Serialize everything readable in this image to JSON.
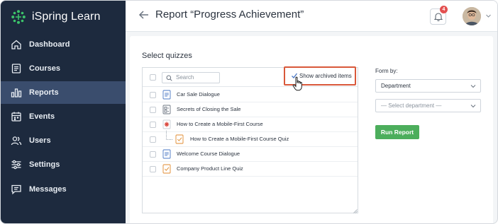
{
  "app": {
    "brand_name": "iSpring Learn",
    "brand_color": "#3cc46a",
    "sidebar_bg": "#1d2a3e",
    "active_bg": "#3a4d6d"
  },
  "sidebar": {
    "items": [
      {
        "label": "Dashboard",
        "icon": "home-icon"
      },
      {
        "label": "Courses",
        "icon": "courses-icon"
      },
      {
        "label": "Reports",
        "icon": "bar-chart-icon",
        "active": true
      },
      {
        "label": "Events",
        "icon": "calendar-icon"
      },
      {
        "label": "Users",
        "icon": "users-icon"
      },
      {
        "label": "Settings",
        "icon": "sliders-icon"
      },
      {
        "label": "Messages",
        "icon": "message-icon"
      }
    ]
  },
  "header": {
    "title": "Report “Progress Achievement”",
    "notification_count": "4"
  },
  "main": {
    "section_title": "Select quizzes",
    "search_placeholder": "Search",
    "show_archived_label": "Show archived items",
    "quizzes": [
      {
        "label": "Car Sale Dialogue",
        "icon": "dialogue-icon"
      },
      {
        "label": "Secrets of Closing the Sale",
        "icon": "course-page-icon"
      },
      {
        "label": "How to Create a Mobile-First Course",
        "icon": "course-star-icon"
      },
      {
        "label": "How to Create a Mobile-First Course Quiz",
        "icon": "quiz-icon"
      },
      {
        "label": "Welcome Course Dialogue",
        "icon": "dialogue-icon"
      },
      {
        "label": "Company Product Line Quiz",
        "icon": "quiz-icon"
      }
    ],
    "form_by_label": "Form by:",
    "form_by_value": "Department",
    "department_placeholder": "— Select department —",
    "run_button": "Run Report",
    "run_button_color": "#4cae5c",
    "highlight_color": "#d9583a"
  }
}
